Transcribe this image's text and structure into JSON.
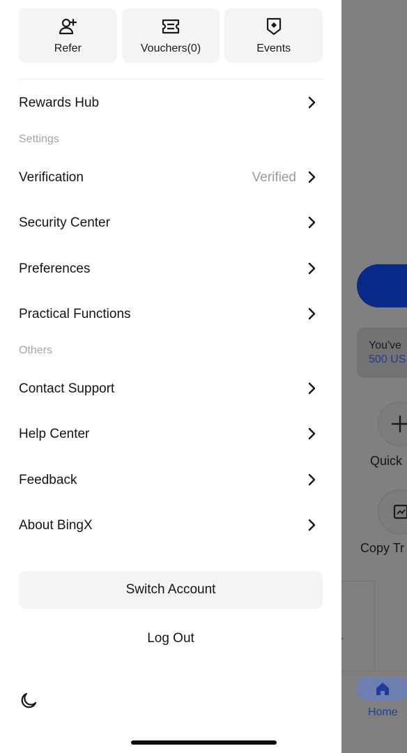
{
  "quick_actions": [
    {
      "label": "Refer",
      "icon": "refer-user-plus-icon"
    },
    {
      "label": "Vouchers(0)",
      "icon": "voucher-ticket-icon"
    },
    {
      "label": "Events",
      "icon": "events-badge-icon"
    }
  ],
  "menu": {
    "rewards_hub": "Rewards Hub",
    "settings_header": "Settings",
    "verification": "Verification",
    "verification_status": "Verified",
    "security_center": "Security Center",
    "preferences": "Preferences",
    "practical_functions": "Practical Functions",
    "others_header": "Others",
    "contact_support": "Contact Support",
    "help_center": "Help Center",
    "feedback": "Feedback",
    "about": "About BingX"
  },
  "actions": {
    "switch_account": "Switch Account",
    "log_out": "Log Out",
    "theme_icon": "moon-icon"
  },
  "background": {
    "banner_line1": "You've",
    "banner_line2": "500 US",
    "quick_label": "Quick",
    "copy_trade_label": "Copy Tr",
    "tab_home": "Home"
  },
  "colors": {
    "accent": "#1e3d9a",
    "muted_text": "#9a9a9a",
    "tile_bg": "#f4f4f4"
  }
}
